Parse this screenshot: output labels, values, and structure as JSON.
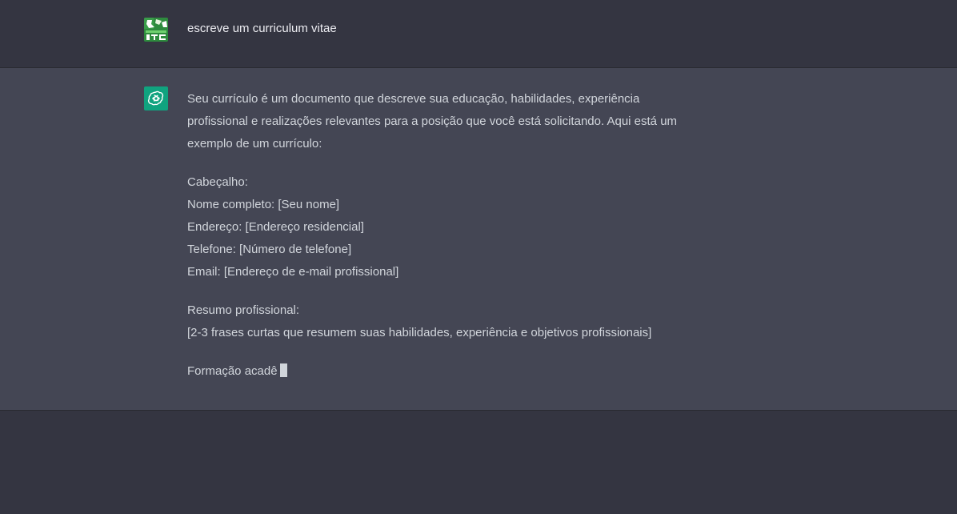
{
  "conversation": {
    "user_message": "escreve um curriculum vitae",
    "assistant": {
      "intro_line1": "Seu currículo é um documento que descreve sua educação, habilidades, experiência",
      "intro_line2": "profissional e realizações relevantes para a posição que você está solicitando. Aqui está um",
      "intro_line3": "exemplo de um currículo:",
      "header_title": "Cabeçalho:",
      "header_name": "Nome completo: [Seu nome]",
      "header_address": "Endereço: [Endereço residencial]",
      "header_phone": "Telefone: [Número de telefone]",
      "header_email": "Email: [Endereço de e-mail profissional]",
      "summary_title": "Resumo profissional:",
      "summary_text": "[2-3 frases curtas que resumem suas habilidades, experiência e objetivos profissionais]",
      "education_partial": "Formação acadê"
    }
  },
  "icons": {
    "user_avatar": "user-avatar-icon",
    "assistant_avatar": "openai-logo-icon"
  },
  "colors": {
    "user_bg": "#343541",
    "assistant_bg": "#444654",
    "assistant_avatar_bg": "#10a37f",
    "text": "#d1d5db"
  }
}
